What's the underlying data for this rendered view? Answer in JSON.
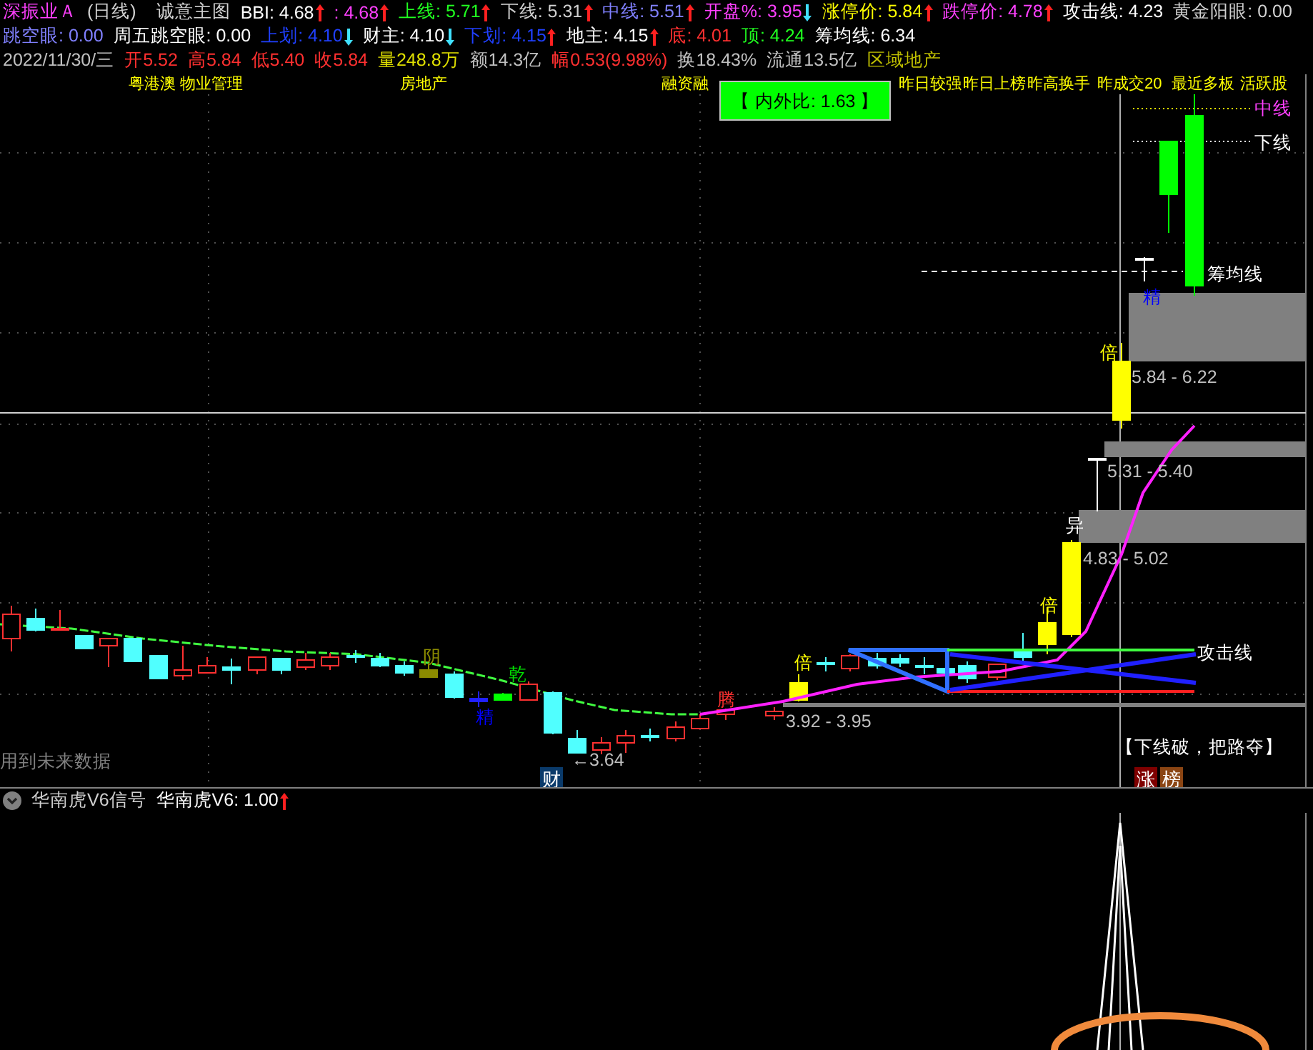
{
  "header": {
    "stock_name": "深振业Ａ",
    "period": "(日线)",
    "template": "诚意主图",
    "indicators": [
      {
        "text": "BBI: 4.68",
        "color": "#ffffff",
        "kind": "rise"
      },
      {
        "text": ": 4.68",
        "color": "#ff40ff",
        "kind": "rise"
      },
      {
        "text": "上线: 5.71",
        "color": "#20ff20",
        "kind": "rise"
      },
      {
        "text": "下线: 5.31",
        "color": "#d0d0d0",
        "kind": "rise"
      },
      {
        "text": "中线: 5.51",
        "color": "#8080ff",
        "kind": "rise"
      },
      {
        "text": "开盘%: 3.95",
        "color": "#ff40ff",
        "kind": "fall"
      },
      {
        "text": "涨停价: 5.84",
        "color": "#ffff00",
        "kind": "rise"
      },
      {
        "text": "跌停价: 4.78",
        "color": "#ff40ff",
        "kind": "rise"
      },
      {
        "text": "攻击线: 4.23",
        "color": "#ffffff"
      },
      {
        "text": "黄金阳眼: 0.00",
        "color": "#d0d0d0"
      }
    ],
    "indicators_row2": [
      {
        "text": "跳空眼: 0.00",
        "color": "#8080ff"
      },
      {
        "text": "周五跳空眼: 0.00",
        "color": "#ffffff"
      },
      {
        "text": "上划: 4.10",
        "color": "#2040ff",
        "kind": "fall"
      },
      {
        "text": "财主: 4.10",
        "color": "#ffffff",
        "kind": "fall"
      },
      {
        "text": "下划: 4.15",
        "color": "#2040ff",
        "kind": "rise"
      },
      {
        "text": "地主: 4.15",
        "color": "#ffffff",
        "kind": "rise"
      },
      {
        "text": "底: 4.01",
        "color": "#ff3030"
      },
      {
        "text": "顶: 4.24",
        "color": "#20ff20"
      },
      {
        "text": "筹均线: 6.34",
        "color": "#ffffff"
      }
    ],
    "quote": [
      {
        "text": "2022/11/30/三",
        "color": "#c0c0c0"
      },
      {
        "text": "开5.52",
        "color": "#ff3030"
      },
      {
        "text": "高5.84",
        "color": "#ff3030"
      },
      {
        "text": "低5.40",
        "color": "#ff3030"
      },
      {
        "text": "收5.84",
        "color": "#ff3030"
      },
      {
        "text": "量248.8万",
        "color": "#e0e000"
      },
      {
        "text": "额14.3亿",
        "color": "#c0c0c0"
      },
      {
        "text": "幅0.53(9.98%)",
        "color": "#ff3030"
      },
      {
        "text": "换18.43%",
        "color": "#c0c0c0"
      },
      {
        "text": "流通13.5亿",
        "color": "#c0c0c0"
      },
      {
        "text": "区域地产",
        "color": "#c0c000"
      }
    ]
  },
  "concept_tags": [
    "粤港澳 物业管理",
    "房地产",
    "融资融",
    "昨日较强",
    "昨日上榜",
    "昨高换手",
    "昨成交20",
    "最近多板",
    "活跃股"
  ],
  "ratio_box": "【 内外比: 1.63 】",
  "line_labels": [
    "中线",
    "下线",
    "筹均线",
    "攻击线"
  ],
  "markers": [
    {
      "text": "阴",
      "kind": "text",
      "color": "#8b8b00"
    },
    {
      "text": "乾",
      "kind": "text",
      "color": "#00e000"
    },
    {
      "text": "精",
      "kind": "text",
      "color": "#0000ff"
    },
    {
      "text": "腾",
      "kind": "text",
      "color": "#ff3030"
    },
    {
      "text": "倍",
      "kind": "text",
      "color": "#ffff00"
    },
    {
      "text": "倍",
      "kind": "text",
      "color": "#ffff00"
    },
    {
      "text": "异",
      "kind": "text",
      "color": "#ffffff"
    },
    {
      "text": "倍",
      "kind": "text",
      "color": "#ffff00"
    },
    {
      "text": "精",
      "kind": "text",
      "color": "#0000ff"
    },
    {
      "text": "5.84 - 6.22",
      "kind": "text",
      "color": "#c0c0c0"
    },
    {
      "text": "5.31 - 5.40",
      "kind": "text",
      "color": "#c0c0c0"
    },
    {
      "text": "4.83 - 5.02",
      "kind": "text",
      "color": "#c0c0c0"
    },
    {
      "text": "3.92 - 3.95",
      "kind": "text",
      "color": "#c0c0c0"
    },
    {
      "text": "←3.64",
      "kind": "text",
      "color": "#c0c0c0"
    },
    {
      "text": "财",
      "kind": "badge",
      "color": "#0a3a6a"
    },
    {
      "text": "用到未来数据",
      "kind": "text",
      "color": "#808080"
    },
    {
      "text": "【下线破，把路夺】",
      "kind": "text",
      "color": "#ffffff"
    },
    {
      "text": "涨",
      "kind": "badge",
      "color": "#800000"
    },
    {
      "text": "榜",
      "kind": "badge",
      "color": "#8b4513"
    }
  ],
  "sub_panel": {
    "name": "华南虎V6信号",
    "indicators": [
      {
        "text": "华南虎V6: 1.00",
        "color": "#ffffff",
        "kind": "rise"
      }
    ]
  }
}
